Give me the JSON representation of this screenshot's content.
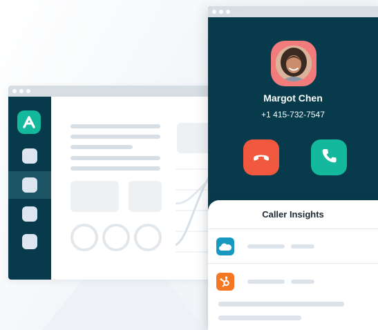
{
  "caller": {
    "name": "Margot Chen",
    "phone": "+1 415-732-7547",
    "avatar_icon": "caller-photo"
  },
  "call_actions": {
    "decline_icon": "phone-hangup-icon",
    "accept_icon": "phone-icon"
  },
  "insights": {
    "title": "Caller Insights",
    "integrations": [
      {
        "name": "Salesforce",
        "icon": "salesforce-cloud-icon",
        "color": "#1798c1"
      },
      {
        "name": "HubSpot",
        "icon": "hubspot-sprocket-icon",
        "color": "#f57722"
      }
    ]
  },
  "colors": {
    "brand_dark": "#073b4c",
    "brand_green": "#14b89c",
    "decline_red": "#f0593e",
    "avatar_bg": "#f27c7c"
  },
  "app": {
    "logo_icon": "app-logo-a-icon"
  }
}
